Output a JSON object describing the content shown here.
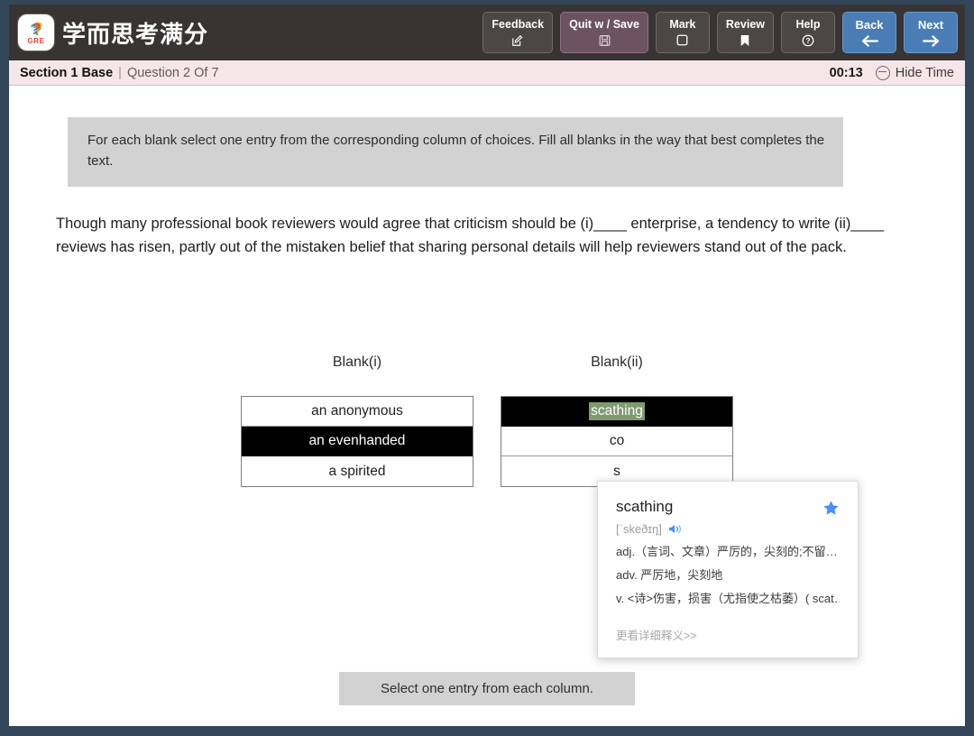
{
  "header": {
    "brand_title": "学而思考满分",
    "logo": {
      "mark": "?",
      "sub": "GRE"
    },
    "buttons": [
      {
        "label": "Feedback",
        "icon": "edit-square-icon",
        "style": "dark"
      },
      {
        "label": "Quit w / Save",
        "icon": "save-disk-icon",
        "style": "quit"
      },
      {
        "label": "Mark",
        "icon": "square-outline-icon",
        "style": "dark"
      },
      {
        "label": "Review",
        "icon": "bookmark-icon",
        "style": "dark"
      },
      {
        "label": "Help",
        "icon": "question-circle-icon",
        "style": "dark"
      },
      {
        "label": "Back",
        "icon": "arrow-left-icon",
        "style": "blue"
      },
      {
        "label": "Next",
        "icon": "arrow-right-icon",
        "style": "blue"
      }
    ]
  },
  "section_bar": {
    "section": "Section 1 Base",
    "separator": "|",
    "question_counter": "Question 2 Of 7",
    "timer": "00:13",
    "hide_time_label": "Hide Time",
    "hide_time_icon": "minus-circle-icon"
  },
  "main": {
    "directions": "For each blank select one entry from the corresponding column of choices. Fill all blanks in the way that best completes the text.",
    "passage": "Though many professional book reviewers would agree that criticism should be (i)____ enterprise, a tendency to write (ii)____ reviews has risen, partly out of the mistaken belief that sharing personal details will help reviewers stand out of the pack.",
    "columns": [
      {
        "label": "Blank(i)",
        "choices": [
          {
            "text": "an anonymous",
            "selected": false,
            "highlighted": false
          },
          {
            "text": "an evenhanded",
            "selected": true,
            "highlighted": false
          },
          {
            "text": "a spirited",
            "selected": false,
            "highlighted": false
          }
        ]
      },
      {
        "label": "Blank(ii)",
        "choices": [
          {
            "text": "scathing",
            "selected": true,
            "highlighted": true
          },
          {
            "text": "co",
            "selected": false,
            "highlighted": false
          },
          {
            "text": "s",
            "selected": false,
            "highlighted": false
          }
        ]
      }
    ],
    "bottom_hint": "Select one entry from each column."
  },
  "dictionary_popup": {
    "word": "scathing",
    "phonetic": "[ˈskeðɪŋ]",
    "speaker_icon": "speaker-icon",
    "star_icon": "star-icon",
    "senses": [
      "adj.（言词、文章）严厉的，尖刻的;不留…",
      "adv. 严厉地，尖刻地",
      "v. <诗>伤害，损害（尤指使之枯萎）( scat…"
    ],
    "more_link": "更看详细释义>>"
  },
  "colors": {
    "frame_border": "#33465a",
    "toolbar_bg": "#373433",
    "section_bar_bg": "#f6e6e9",
    "blue_button": "#4a7db5",
    "quit_button": "#6d5361",
    "directions_bg": "#d2d2d2",
    "selected_row": "#000000",
    "highlight_green": "#7f9a70",
    "star_blue": "#4d8ef7"
  }
}
